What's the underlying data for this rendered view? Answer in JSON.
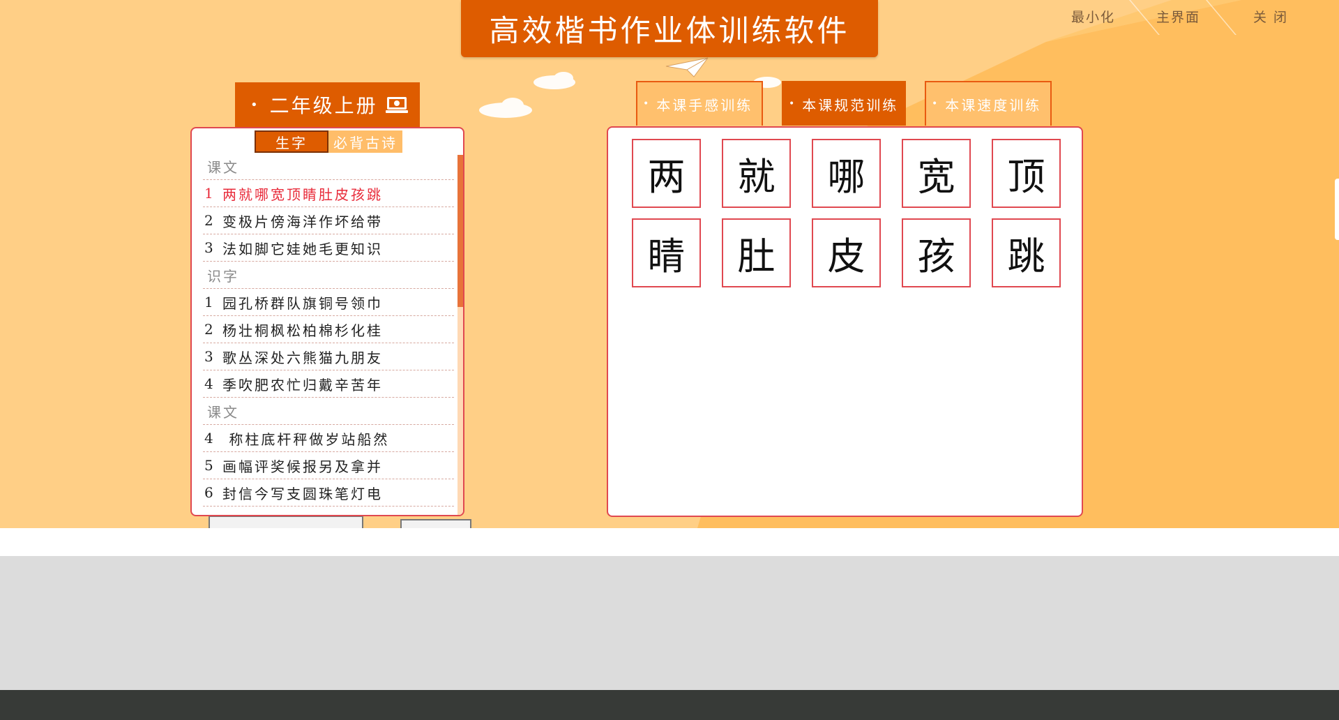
{
  "app_title": "高效楷书作业体训练软件",
  "window_controls": {
    "minimize": "最小化",
    "main": "主界面",
    "close": "关 闭"
  },
  "grade": {
    "label": "二年级上册",
    "icon": "monitor-book-icon"
  },
  "subtabs": [
    {
      "label": "生字",
      "active": true
    },
    {
      "label": "必背古诗",
      "active": false
    }
  ],
  "lessons": [
    {
      "type": "section",
      "text": "课文"
    },
    {
      "type": "item",
      "num": "1",
      "text": "两就哪宽顶睛肚皮孩跳",
      "selected": true
    },
    {
      "type": "item",
      "num": "2",
      "text": "变极片傍海洋作坏给带"
    },
    {
      "type": "item",
      "num": "3",
      "text": "法如脚它娃她毛更知识"
    },
    {
      "type": "section",
      "text": "识字"
    },
    {
      "type": "item",
      "num": "1",
      "text": "园孔桥群队旗铜号领巾"
    },
    {
      "type": "item",
      "num": "2",
      "text": "杨壮桐枫松柏棉杉化桂"
    },
    {
      "type": "item",
      "num": "3",
      "text": "歌丛深处六熊猫九朋友"
    },
    {
      "type": "item",
      "num": "4",
      "text": "季吹肥农忙归戴辛苦年"
    },
    {
      "type": "section",
      "text": "课文"
    },
    {
      "type": "item",
      "num": "4",
      "text": " 称柱底杆秤做岁站船然"
    },
    {
      "type": "item",
      "num": "5",
      "text": "画幅评奖候报另及拿并"
    },
    {
      "type": "item",
      "num": "6",
      "text": "封信今写支圆珠笔灯电"
    }
  ],
  "training_tabs": [
    {
      "label": "本课手感训练",
      "active": false
    },
    {
      "label": "本课规范训练",
      "active": true
    },
    {
      "label": "本课速度训练",
      "active": false
    }
  ],
  "characters": [
    "两",
    "就",
    "哪",
    "宽",
    "顶",
    "睛",
    "肚",
    "皮",
    "孩",
    "跳"
  ],
  "colors": {
    "accent": "#de5c00",
    "background": "#ffcf86",
    "grid_border": "#e04850",
    "selected_text": "#e82b3a"
  }
}
